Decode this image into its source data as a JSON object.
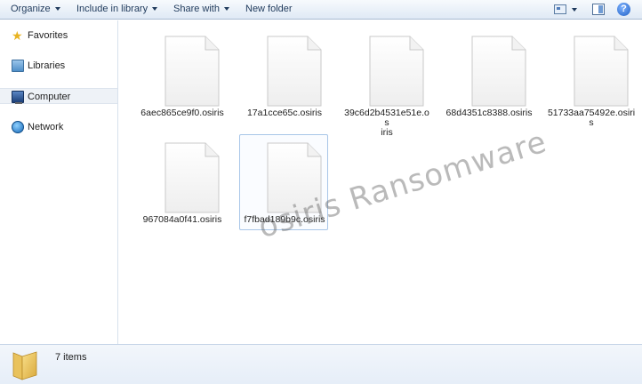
{
  "toolbar": {
    "organize": "Organize",
    "include_in_library": "Include in library",
    "share_with": "Share with",
    "new_folder": "New folder"
  },
  "nav": {
    "items": [
      {
        "label": "Favorites",
        "icon": "star-icon"
      },
      {
        "label": "Libraries",
        "icon": "libraries-icon"
      },
      {
        "label": "Computer",
        "icon": "computer-icon",
        "selected": true
      },
      {
        "label": "Network",
        "icon": "network-icon"
      }
    ]
  },
  "files": [
    {
      "name": "6aec865ce9f0.osiris"
    },
    {
      "name": "17a1cce65c.osiris"
    },
    {
      "name": "39c6d2b4531e51e.os\niris"
    },
    {
      "name": "68d4351c8388.osiris"
    },
    {
      "name": "51733aa75492e.osiris"
    },
    {
      "name": "967084a0f41.osiris"
    },
    {
      "name": "f7fbad189b9c.osiris",
      "selected": true
    }
  ],
  "watermark": "osiris Ransomware",
  "status": {
    "items_count": "7 items"
  },
  "colors": {
    "toolbar_text": "#1e395b",
    "selection_border": "#a8c6e8",
    "watermark": "#5a5a5a"
  }
}
